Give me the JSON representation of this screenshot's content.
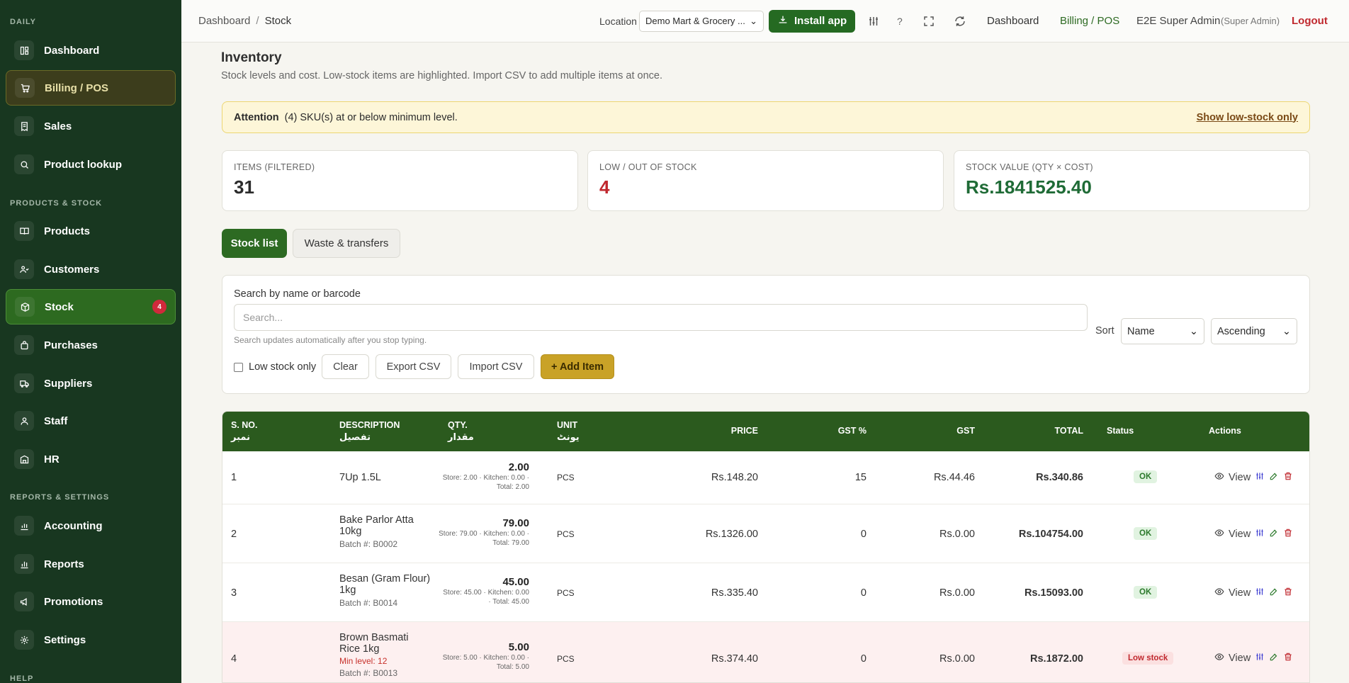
{
  "sidebar": {
    "sections": {
      "daily": "DAILY",
      "products": "PRODUCTS & STOCK",
      "reports": "REPORTS & SETTINGS",
      "help": "HELP"
    },
    "items": [
      {
        "label": "Dashboard",
        "icon": "grid-icon"
      },
      {
        "label": "Billing / POS",
        "icon": "cart-icon"
      },
      {
        "label": "Sales",
        "icon": "receipt-icon"
      },
      {
        "label": "Product lookup",
        "icon": "search-icon"
      },
      {
        "label": "Products",
        "icon": "book-icon"
      },
      {
        "label": "Customers",
        "icon": "users-icon"
      },
      {
        "label": "Stock",
        "icon": "box-icon",
        "badge": "4"
      },
      {
        "label": "Purchases",
        "icon": "bag-icon"
      },
      {
        "label": "Suppliers",
        "icon": "truck-icon"
      },
      {
        "label": "Staff",
        "icon": "person-icon"
      },
      {
        "label": "HR",
        "icon": "building-icon"
      },
      {
        "label": "Accounting",
        "icon": "chart-icon"
      },
      {
        "label": "Reports",
        "icon": "bar-chart-icon"
      },
      {
        "label": "Promotions",
        "icon": "megaphone-icon"
      },
      {
        "label": "Settings",
        "icon": "gear-icon"
      }
    ]
  },
  "topbar": {
    "breadcrumb": {
      "root": "Dashboard",
      "sep": "/",
      "current": "Stock"
    },
    "location_label": "Location",
    "location_value": "Demo Mart & Grocery ...",
    "install": "Install app",
    "help": "?",
    "nav_dashboard": "Dashboard",
    "nav_billing": "Billing / POS",
    "user_name": "E2E Super Admin",
    "user_role": "(Super Admin)",
    "logout": "Logout"
  },
  "page": {
    "title": "Inventory",
    "subtitle": "Stock levels and cost. Low-stock items are highlighted. Import CSV to add multiple items at once."
  },
  "alert": {
    "label": "Attention",
    "text": "(4) SKU(s) at or below minimum level.",
    "link": "Show low-stock only"
  },
  "stats": [
    {
      "label": "ITEMS (FILTERED)",
      "value": "31",
      "color": "#2b2b2b"
    },
    {
      "label": "LOW / OUT OF STOCK",
      "value": "4",
      "color": "#c0282e"
    },
    {
      "label": "STOCK VALUE (QTY × COST)",
      "value": "Rs.1841525.40",
      "color": "#1f6b36"
    }
  ],
  "tabs": {
    "stock_list": "Stock list",
    "waste": "Waste & transfers"
  },
  "filters": {
    "search_label": "Search by name or barcode",
    "search_placeholder": "Search...",
    "hint": "Search updates automatically after you stop typing.",
    "sort_label": "Sort",
    "sort_by": "Name",
    "sort_order": "Ascending",
    "low_stock_only": "Low stock only",
    "clear": "Clear",
    "export": "Export CSV",
    "import": "Import CSV",
    "add": "+ Add Item"
  },
  "table": {
    "headers": {
      "sno": "S. NO.",
      "sno_ur": "نمبر",
      "desc": "DESCRIPTION",
      "desc_ur": "تفصیل",
      "qty": "QTY.",
      "qty_ur": "مقدار",
      "unit": "UNIT",
      "unit_ur": "یونٹ",
      "price": "PRICE",
      "gst_pct": "GST %",
      "gst": "GST",
      "total": "TOTAL",
      "status": "Status",
      "actions": "Actions"
    },
    "view_label": "View",
    "rows": [
      {
        "sno": "1",
        "name": "7Up 1.5L",
        "name2": "",
        "batch": "",
        "min": "",
        "qty": "2.00",
        "qty_detail1": "Store: 2.00 · Kitchen: 0.00 ·",
        "qty_detail2": "Total: 2.00",
        "unit": "PCS",
        "price": "Rs.148.20",
        "gst_pct": "15",
        "gst": "Rs.44.46",
        "total": "Rs.340.86",
        "status": "OK"
      },
      {
        "sno": "2",
        "name": "Bake Parlor Atta",
        "name2": "10kg",
        "batch": "Batch #: B0002",
        "min": "",
        "qty": "79.00",
        "qty_detail1": "Store: 79.00 · Kitchen: 0.00 ·",
        "qty_detail2": "Total: 79.00",
        "unit": "PCS",
        "price": "Rs.1326.00",
        "gst_pct": "0",
        "gst": "Rs.0.00",
        "total": "Rs.104754.00",
        "status": "OK"
      },
      {
        "sno": "3",
        "name": "Besan (Gram Flour)",
        "name2": "1kg",
        "batch": "Batch #: B0014",
        "min": "",
        "qty": "45.00",
        "qty_detail1": "Store: 45.00 · Kitchen: 0.00",
        "qty_detail2": "· Total: 45.00",
        "unit": "PCS",
        "price": "Rs.335.40",
        "gst_pct": "0",
        "gst": "Rs.0.00",
        "total": "Rs.15093.00",
        "status": "OK"
      },
      {
        "sno": "4",
        "name": "Brown Basmati",
        "name2": "Rice 1kg",
        "batch": "Batch #: B0013",
        "min": "Min level: 12",
        "qty": "5.00",
        "qty_detail1": "Store: 5.00 · Kitchen: 0.00 ·",
        "qty_detail2": "Total: 5.00",
        "unit": "PCS",
        "price": "Rs.374.40",
        "gst_pct": "0",
        "gst": "Rs.0.00",
        "total": "Rs.1872.00",
        "status": "Low stock"
      }
    ]
  },
  "colors": {
    "sidebar": "#183720",
    "accent": "#2d6a22",
    "gold": "#c9a227",
    "danger": "#c0282e"
  }
}
